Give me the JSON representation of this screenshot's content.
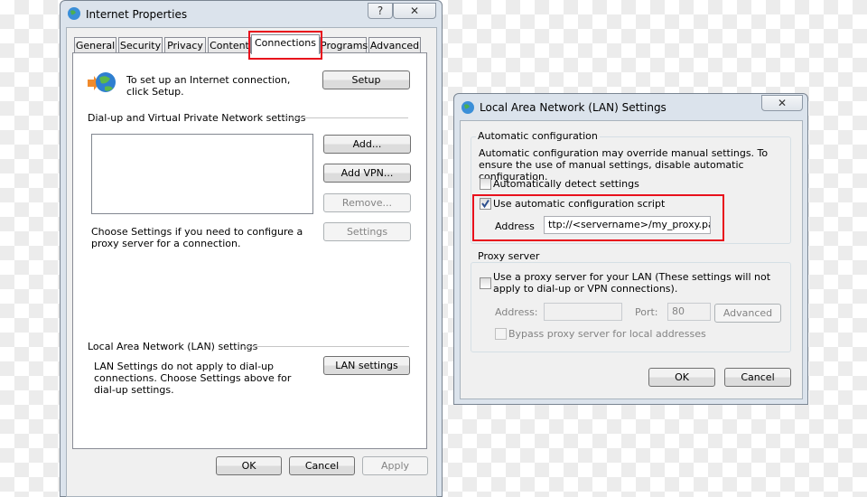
{
  "internet_properties": {
    "title": "Internet Properties",
    "help_icon": "?",
    "close_icon": "✕",
    "tabs": [
      "General",
      "Security",
      "Privacy",
      "Content",
      "Connections",
      "Programs",
      "Advanced"
    ],
    "active_tab": "Connections",
    "setup_text": "To set up an Internet connection, click Setup.",
    "setup_button": "Setup",
    "dialup_section": "Dial-up and Virtual Private Network settings",
    "add_button": "Add...",
    "add_vpn_button": "Add VPN...",
    "remove_button": "Remove...",
    "settings_text": "Choose Settings if you need to configure a proxy server for a connection.",
    "settings_button": "Settings",
    "lan_section": "Local Area Network (LAN) settings",
    "lan_text": "LAN Settings do not apply to dial-up connections. Choose Settings above for dial-up settings.",
    "lan_button": "LAN settings",
    "ok": "OK",
    "cancel": "Cancel",
    "apply": "Apply"
  },
  "lan_settings": {
    "title": "Local Area Network (LAN) Settings",
    "close_icon": "✕",
    "auto_group": "Automatic configuration",
    "auto_desc": "Automatic configuration may override manual settings.  To ensure the use of manual settings, disable automatic configuration.",
    "auto_detect": {
      "label": "Automatically detect settings",
      "checked": false
    },
    "use_script": {
      "label": "Use automatic configuration script",
      "checked": true
    },
    "address_label": "Address",
    "address_value": "ttp://<servername>/my_proxy.pac",
    "proxy_group": "Proxy server",
    "use_proxy": {
      "label": "Use a proxy server for your LAN (These settings will not apply to dial-up or VPN connections).",
      "checked": false
    },
    "proxy_address_label": "Address:",
    "proxy_address_value": "",
    "port_label": "Port:",
    "port_value": "80",
    "advanced_button": "Advanced",
    "bypass": {
      "label": "Bypass proxy server for local addresses",
      "checked": false
    },
    "ok": "OK",
    "cancel": "Cancel"
  },
  "highlight_color": "#e8101c"
}
